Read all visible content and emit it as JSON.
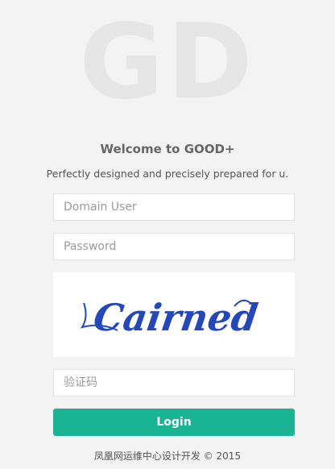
{
  "logo": {
    "text": "GD"
  },
  "header": {
    "title": "Welcome to GOOD+",
    "subtitle": "Perfectly designed and precisely prepared for u."
  },
  "form": {
    "username_placeholder": "Domain User",
    "password_placeholder": "Password",
    "captcha_text": "Cairned",
    "code_placeholder": "验证码",
    "login_label": "Login"
  },
  "footer": {
    "text": "凤凰网运维中心设计开发 © 2015"
  },
  "colors": {
    "accent": "#1ab394",
    "background": "#f3f3f3",
    "captcha_ink": "#2548b8"
  }
}
